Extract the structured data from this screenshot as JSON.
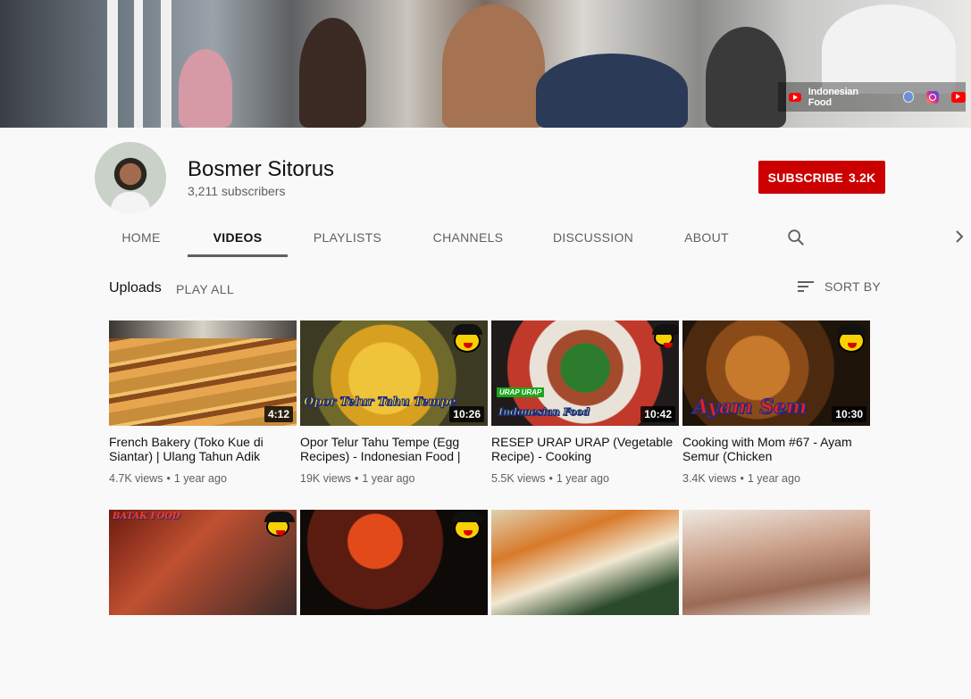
{
  "banner": {
    "link_label": "Indonesian Food"
  },
  "channel": {
    "name": "Bosmer Sitorus",
    "subscribers": "3,211 subscribers",
    "subscribe_label": "SUBSCRIBE",
    "subscribe_count": "3.2K"
  },
  "tabs": [
    {
      "label": "HOME"
    },
    {
      "label": "VIDEOS"
    },
    {
      "label": "PLAYLISTS"
    },
    {
      "label": "CHANNELS"
    },
    {
      "label": "DISCUSSION"
    },
    {
      "label": "ABOUT"
    }
  ],
  "uploads": {
    "heading": "Uploads",
    "play_all": "PLAY ALL",
    "sort_by": "SORT BY"
  },
  "thumb_overlays": {
    "v2": "Opor Telur Tahu Tempe",
    "v3_tag": "URAP URAP",
    "v3": "Indonesian Food",
    "v4": "Ayam Sem",
    "v5": "BATAK FOOD"
  },
  "videos": [
    {
      "title": "French Bakery (Toko Kue di Siantar) | Ulang Tahun Adik",
      "duration": "4:12",
      "views": "4.7K views",
      "age": "1 year ago"
    },
    {
      "title": "Opor Telur Tahu Tempe (Egg Recipes) - Indonesian Food |",
      "duration": "10:26",
      "views": "19K views",
      "age": "1 year ago"
    },
    {
      "title": "RESEP URAP URAP (Vegetable Recipe) - Cooking",
      "duration": "10:42",
      "views": "5.5K views",
      "age": "1 year ago"
    },
    {
      "title": "Cooking with Mom #67 - Ayam Semur (Chicken",
      "duration": "10:30",
      "views": "3.4K views",
      "age": "1 year ago"
    }
  ]
}
